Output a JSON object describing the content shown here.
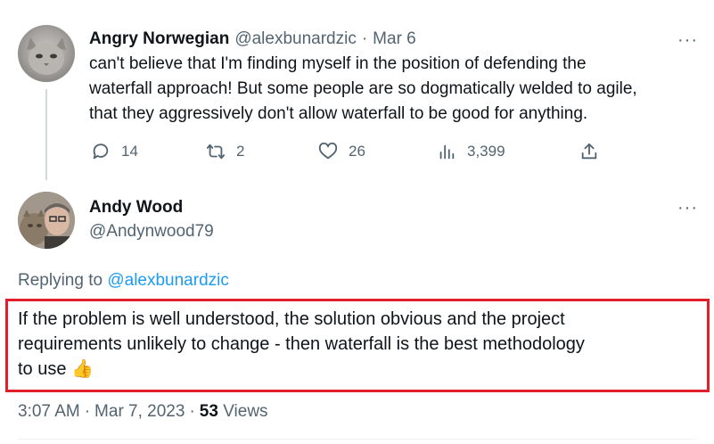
{
  "parent_tweet": {
    "author_name": "Angry Norwegian",
    "author_handle": "@alexbunardzic",
    "separator": "·",
    "date": "Mar 6",
    "text_lines": [
      "can't believe that I'm finding myself in the position of defending the",
      "waterfall approach! But some people are so dogmatically welded to agile,",
      "that they aggressively don't allow waterfall to be good for anything."
    ],
    "actions": {
      "replies": "14",
      "retweets": "2",
      "likes": "26",
      "views": "3,399"
    }
  },
  "reply_tweet": {
    "author_name": "Andy Wood",
    "author_handle": "@Andynwood79",
    "replying_prefix": "Replying to",
    "replying_to": "@alexbunardzic",
    "text_lines": [
      "If the problem is well understood, the solution obvious and the project",
      "requirements unlikely to change - then waterfall is the best methodology",
      "to use"
    ],
    "emoji": "👍",
    "time": "3:07 AM",
    "date": "Mar 7, 2023",
    "separator": "·",
    "views_count": "53",
    "views_label": "Views"
  },
  "more_label": "···",
  "highlight_color": "#e0202a",
  "link_color": "#1d9bf0",
  "muted_color": "#536471"
}
